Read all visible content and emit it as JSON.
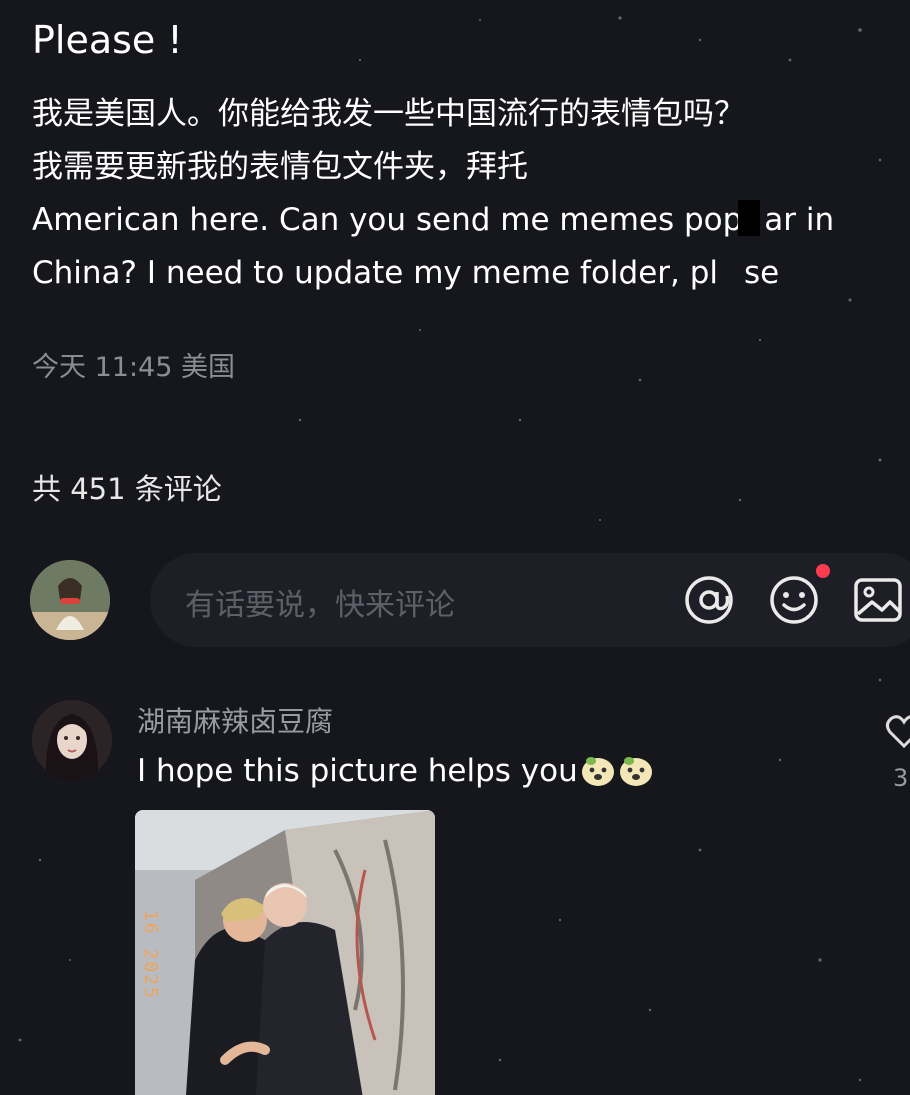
{
  "post": {
    "title": "Please !",
    "body_lines": [
      "我是美国人。你能给我发一些中国流行的表情包吗？",
      "我需要更新我的表情包文件夹，拜托",
      "American here. Can you send me memes pop",
      "ar in",
      "China? I need to update my meme folder, pl",
      "se"
    ],
    "meta": "今天 11:45 美国"
  },
  "comments_header": "共 451 条评论",
  "composer": {
    "placeholder": "有话要说，快来评论",
    "icons": [
      "at-icon",
      "emoji-icon",
      "image-icon"
    ],
    "notification_color": "#ff3b4f"
  },
  "comment": {
    "username": "湖南麻辣卤豆腐",
    "text": "I hope this picture helps you",
    "emoji_count": 2,
    "like_count": "3",
    "image_watermark": "16 2025"
  },
  "colors": {
    "background": "#16161d",
    "text_primary": "#ffffff",
    "text_secondary": "#8c8c94",
    "input_background": "#1e1e26"
  }
}
